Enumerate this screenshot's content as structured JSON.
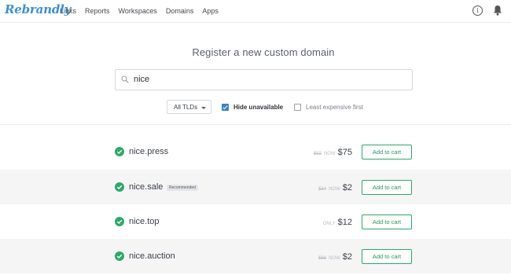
{
  "app": {
    "logo_text": "Rebrandly"
  },
  "nav": {
    "links": [
      "Links",
      "Reports",
      "Workspaces",
      "Domains",
      "Apps"
    ],
    "info_icon": "info-icon",
    "bell_icon": "bell-icon"
  },
  "header": {
    "title": "Register a new custom domain"
  },
  "search": {
    "value": "nice",
    "icon": "search-icon"
  },
  "filters": {
    "tld_select": "All TLDs",
    "hide_unavailable": {
      "label": "Hide unavailable",
      "checked": true
    },
    "least_expensive": {
      "label": "Least expensive first",
      "checked": false
    }
  },
  "results": [
    {
      "domain": "nice.press",
      "badge": "",
      "old_price": "$92",
      "price_tag": "NOW",
      "price": "$75",
      "action": "Add to cart"
    },
    {
      "domain": "nice.sale",
      "badge": "Recommended",
      "old_price": "$34",
      "price_tag": "NOW",
      "price": "$2",
      "action": "Add to cart"
    },
    {
      "domain": "nice.top",
      "badge": "",
      "old_price": "",
      "price_tag": "ONLY",
      "price": "$12",
      "action": "Add to cart"
    },
    {
      "domain": "nice.auction",
      "badge": "",
      "old_price": "$66",
      "price_tag": "NOW",
      "price": "$2",
      "action": "Add to cart"
    }
  ],
  "colors": {
    "brand": "#3d8fd1",
    "success": "#2fa86a",
    "checkbox": "#3b82c4",
    "row_alt": "#f5f5f6"
  }
}
